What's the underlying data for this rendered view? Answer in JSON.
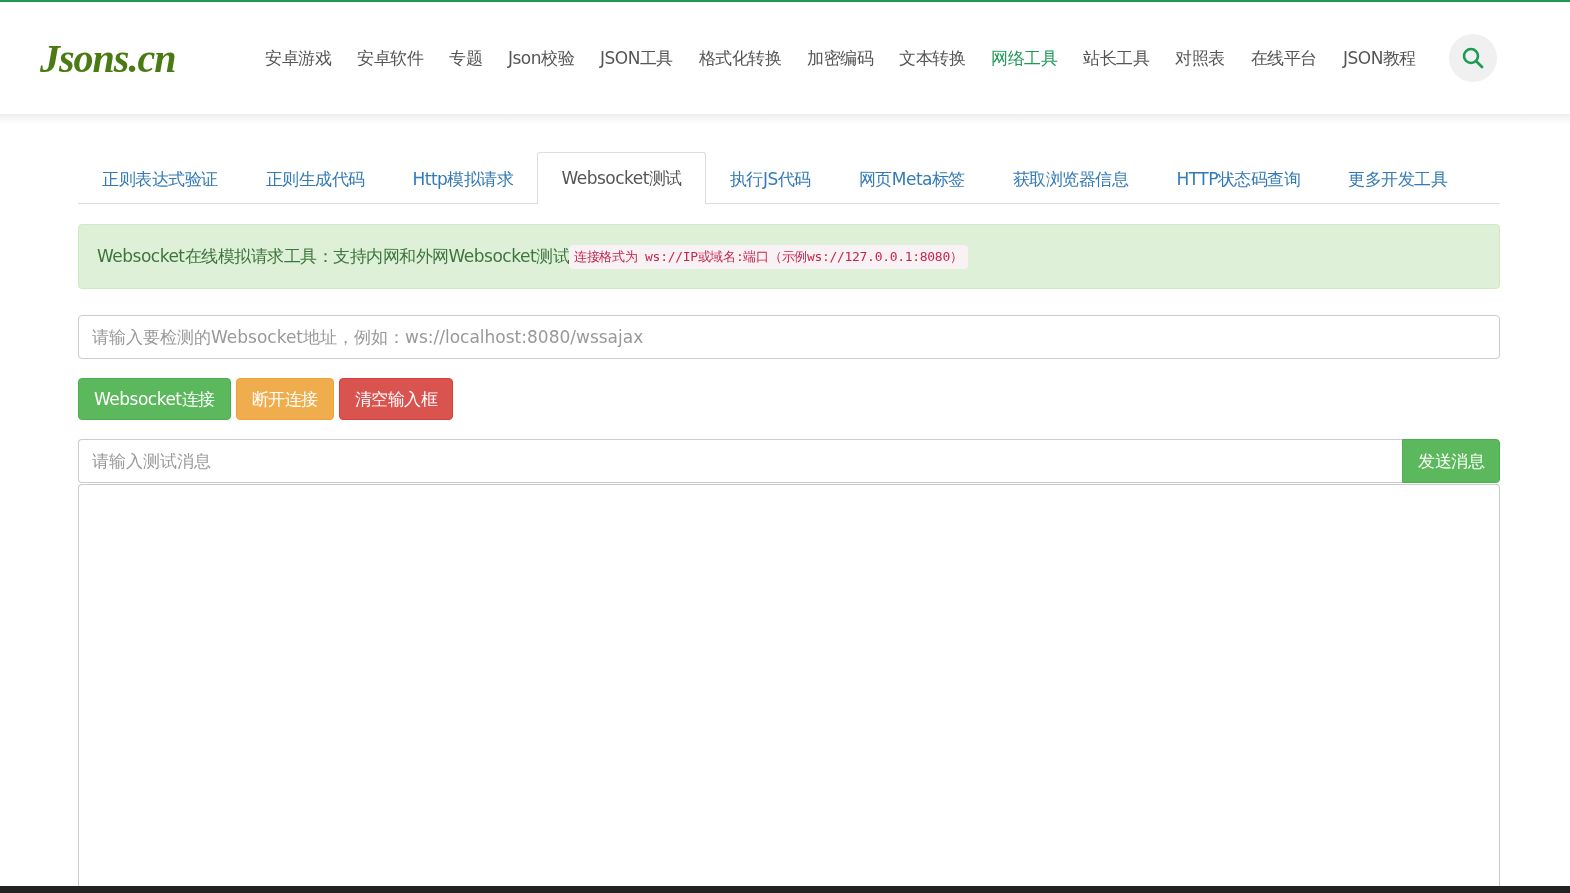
{
  "header": {
    "logo": "Jsons.cn",
    "nav": [
      {
        "label": "安卓游戏",
        "selected": false
      },
      {
        "label": "安卓软件",
        "selected": false
      },
      {
        "label": "专题",
        "selected": false
      },
      {
        "label": "Json校验",
        "selected": false
      },
      {
        "label": "JSON工具",
        "selected": false
      },
      {
        "label": "格式化转换",
        "selected": false
      },
      {
        "label": "加密编码",
        "selected": false
      },
      {
        "label": "文本转换",
        "selected": false
      },
      {
        "label": "网络工具",
        "selected": true
      },
      {
        "label": "站长工具",
        "selected": false
      },
      {
        "label": "对照表",
        "selected": false
      },
      {
        "label": "在线平台",
        "selected": false
      },
      {
        "label": "JSON教程",
        "selected": false
      }
    ]
  },
  "tabs": [
    {
      "label": "正则表达式验证",
      "selected": false
    },
    {
      "label": "正则生成代码",
      "selected": false
    },
    {
      "label": "Http模拟请求",
      "selected": false
    },
    {
      "label": "Websocket测试",
      "selected": true
    },
    {
      "label": "执行JS代码",
      "selected": false
    },
    {
      "label": "网页Meta标签",
      "selected": false
    },
    {
      "label": "获取浏览器信息",
      "selected": false
    },
    {
      "label": "HTTP状态码查询",
      "selected": false
    },
    {
      "label": "更多开发工具",
      "selected": false
    }
  ],
  "notice": {
    "text": "Websocket在线模拟请求工具：支持内网和外网Websocket测试",
    "code": "连接格式为 ws://IP或域名:端口（示例ws://127.0.0.1:8080）"
  },
  "url_field": {
    "placeholder": "请输入要检测的Websocket地址，例如：ws://localhost:8080/wssajax"
  },
  "buttons": [
    {
      "label": "Websocket连接",
      "kind": "success"
    },
    {
      "label": "断开连接",
      "kind": "warning"
    },
    {
      "label": "清空输入框",
      "kind": "danger"
    }
  ],
  "message_field": {
    "placeholder": "请输入测试消息"
  },
  "send_button": "发送消息"
}
